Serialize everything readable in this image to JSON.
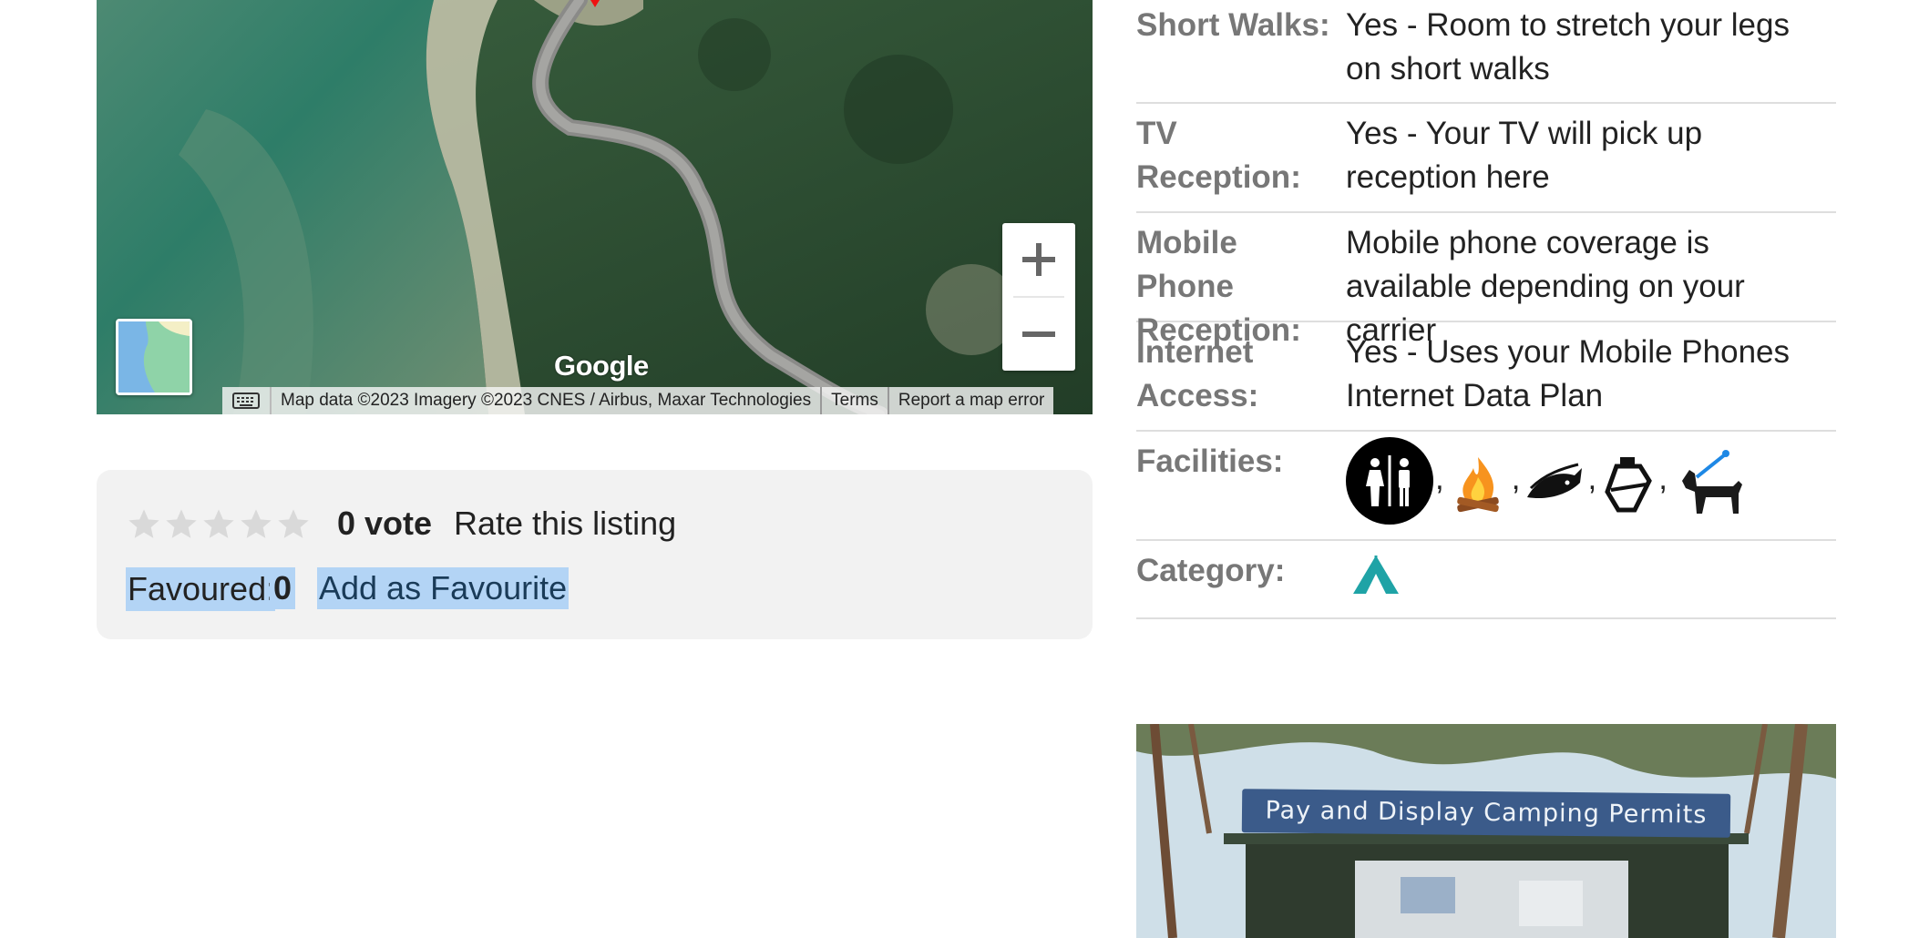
{
  "map": {
    "logo_text": "Google",
    "attribution": "Map data ©2023 Imagery ©2023 CNES / Airbus, Maxar Technologies",
    "terms_label": "Terms",
    "report_label": "Report a map error"
  },
  "rating": {
    "stars_total": 5,
    "stars_filled": 0,
    "vote_text": "0 vote",
    "rate_label": "Rate this listing",
    "favoured_label": "Favoured:",
    "favoured_count": "0",
    "favourite_link": "Add as Favourite"
  },
  "details": [
    {
      "label": "Short Walks:",
      "value": "Yes - Room to stretch your legs on short walks"
    },
    {
      "label": "TV Reception:",
      "value": "Yes - Your TV will pick up reception here"
    },
    {
      "label": "Mobile Phone Reception:",
      "value": "Mobile phone coverage is available depending on your carrier"
    },
    {
      "label": "Internet Access:",
      "value": "Yes - Uses your Mobile Phones Internet Data Plan"
    },
    {
      "label": "Facilities:",
      "icons": [
        "toilets-icon",
        "campfire-icon",
        "fishing-icon",
        "drinking-water-icon",
        "dog-friendly-icon"
      ],
      "separator": ","
    },
    {
      "label": "Category:",
      "icons": [
        "tent-icon"
      ]
    }
  ],
  "photo": {
    "sign_text": "Pay and Display Camping Permits"
  },
  "colors": {
    "label_gray": "#777777",
    "box_bg": "#f2f2f2",
    "selection": "#b3d4f5",
    "tent_teal": "#1fa3a6"
  }
}
